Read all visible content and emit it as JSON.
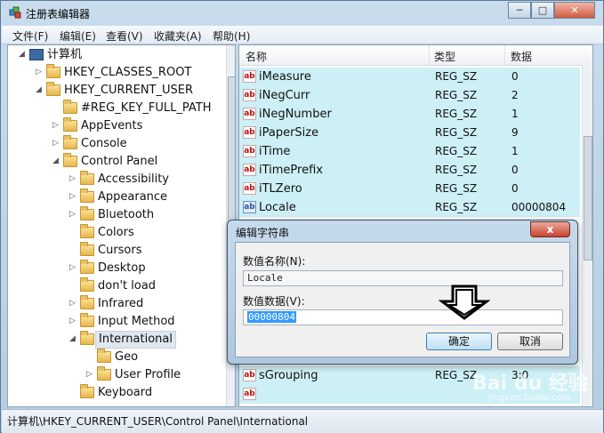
{
  "window": {
    "title": "注册表编辑器",
    "controls": {
      "minimize": "─",
      "maximize": "□",
      "close": "✕"
    }
  },
  "menu": [
    "文件(F)",
    "编辑(E)",
    "查看(V)",
    "收藏夹(A)",
    "帮助(H)"
  ],
  "tree": {
    "root": "计算机",
    "items": [
      {
        "label": "HKEY_CLASSES_ROOT",
        "expander": "▷"
      },
      {
        "label": "HKEY_CURRENT_USER",
        "expander": "◢"
      },
      {
        "label": "#REG_KEY_FULL_PATH",
        "expander": ""
      },
      {
        "label": "AppEvents",
        "expander": "▷"
      },
      {
        "label": "Console",
        "expander": "▷"
      },
      {
        "label": "Control Panel",
        "expander": "◢"
      },
      {
        "label": "Accessibility",
        "expander": "▷"
      },
      {
        "label": "Appearance",
        "expander": "▷"
      },
      {
        "label": "Bluetooth",
        "expander": "▷"
      },
      {
        "label": "Colors",
        "expander": ""
      },
      {
        "label": "Cursors",
        "expander": ""
      },
      {
        "label": "Desktop",
        "expander": "▷"
      },
      {
        "label": "don't load",
        "expander": ""
      },
      {
        "label": "Infrared",
        "expander": "▷"
      },
      {
        "label": "Input Method",
        "expander": "▷"
      },
      {
        "label": "International",
        "expander": "◢"
      },
      {
        "label": "Geo",
        "expander": ""
      },
      {
        "label": "User Profile",
        "expander": "▷"
      },
      {
        "label": "Keyboard",
        "expander": ""
      }
    ]
  },
  "list": {
    "headers": {
      "name": "名称",
      "type": "类型",
      "data": "数据"
    },
    "rows": [
      {
        "name": "iMeasure",
        "type": "REG_SZ",
        "data": "0"
      },
      {
        "name": "iNegCurr",
        "type": "REG_SZ",
        "data": "2"
      },
      {
        "name": "iNegNumber",
        "type": "REG_SZ",
        "data": "1"
      },
      {
        "name": "iPaperSize",
        "type": "REG_SZ",
        "data": "9"
      },
      {
        "name": "iTime",
        "type": "REG_SZ",
        "data": "1"
      },
      {
        "name": "iTimePrefix",
        "type": "REG_SZ",
        "data": "0"
      },
      {
        "name": "iTLZero",
        "type": "REG_SZ",
        "data": "0"
      },
      {
        "name": "Locale",
        "type": "REG_SZ",
        "data": "00000804"
      }
    ],
    "bottom_rows": [
      {
        "name": "sGrouping",
        "type": "REG_SZ",
        "data": "3;0"
      }
    ],
    "icon_text": "ab"
  },
  "status": {
    "path": "计算机\\HKEY_CURRENT_USER\\Control Panel\\International"
  },
  "dialog": {
    "title": "编辑字符串",
    "close": "x",
    "name_label": "数值名称(N):",
    "name_value": "Locale",
    "data_label": "数值数据(V):",
    "data_value": "00000804",
    "ok": "确定",
    "cancel": "取消"
  },
  "watermark": {
    "main": "Bai du 经验",
    "sub": "jingyan.baidu.com"
  }
}
